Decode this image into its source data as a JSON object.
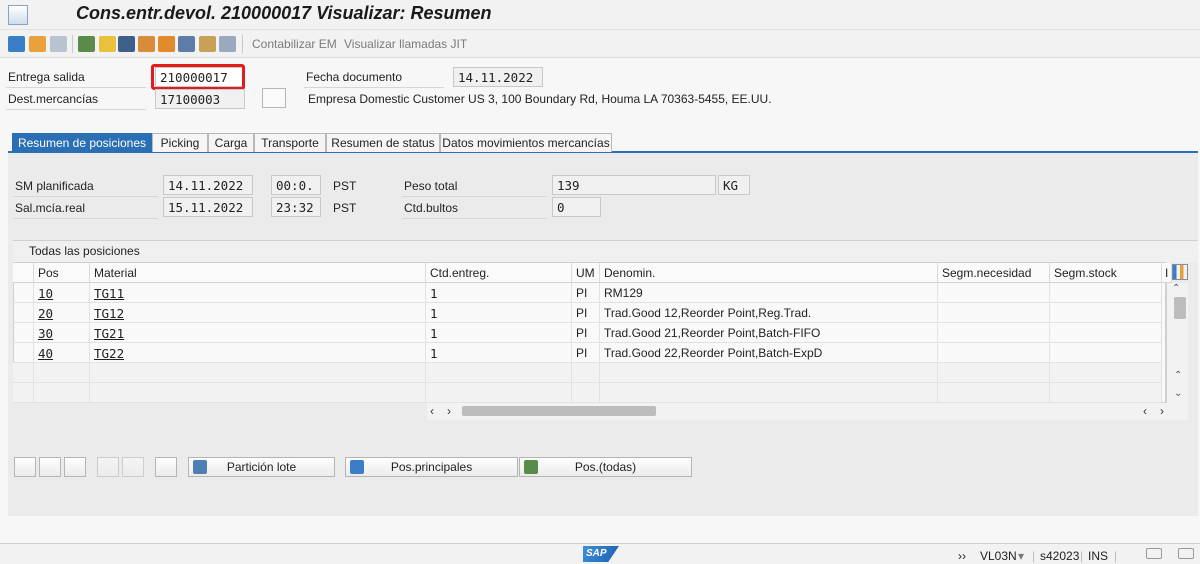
{
  "window": {
    "title": "Cons.entr.devol. 210000017 Visualizar: Resumen"
  },
  "toolbar": {
    "post_goods_receipt": "Contabilizar EM",
    "view_jit_calls": "Visualizar llamadas JIT"
  },
  "header": {
    "outbound_delivery_label": "Entrega salida",
    "outbound_delivery_value": "210000017",
    "doc_date_label": "Fecha documento",
    "doc_date_value": "14.11.2022",
    "ship_to_label": "Dest.mercancías",
    "ship_to_value": "17100003",
    "ship_to_address": "Empresa Domestic Customer US 3, 100 Boundary Rd, Houma LA 70363-5455, EE.UU."
  },
  "tabs": [
    {
      "label": "Resumen de posiciones",
      "active": true
    },
    {
      "label": "Picking"
    },
    {
      "label": "Carga"
    },
    {
      "label": "Transporte"
    },
    {
      "label": "Resumen de status"
    },
    {
      "label": "Datos movimientos mercancías"
    }
  ],
  "overview": {
    "planned_gi_label": "SM planificada",
    "planned_gi_date": "14.11.2022",
    "planned_gi_time": "00:0.",
    "planned_gi_tz": "PST",
    "actual_gi_label": "Sal.mcía.real",
    "actual_gi_date": "15.11.2022",
    "actual_gi_time": "23:32",
    "actual_gi_tz": "PST",
    "total_weight_label": "Peso total",
    "total_weight_value": "139",
    "weight_unit": "KG",
    "packages_label": "Ctd.bultos",
    "packages_value": "0"
  },
  "items_table": {
    "title": "Todas las posiciones",
    "columns": [
      "Pos",
      "Material",
      "Ctd.entreg.",
      "UM",
      "Denomin.",
      "Segm.necesidad",
      "Segm.stock",
      "I"
    ],
    "rows": [
      {
        "pos": "10",
        "material": "TG11",
        "qty": "1",
        "uom": "PI",
        "desc": "RM129"
      },
      {
        "pos": "20",
        "material": "TG12",
        "qty": "1",
        "uom": "PI",
        "desc": "Trad.Good 12,Reorder Point,Reg.Trad."
      },
      {
        "pos": "30",
        "material": "TG21",
        "qty": "1",
        "uom": "PI",
        "desc": "Trad.Good 21,Reorder Point,Batch-FIFO"
      },
      {
        "pos": "40",
        "material": "TG22",
        "qty": "1",
        "uom": "PI",
        "desc": "Trad.Good 22,Reorder Point,Batch-ExpD"
      }
    ]
  },
  "buttons": {
    "batch_split": "Partición lote",
    "main_items": "Pos.principales",
    "all_items": "Pos.(todas)"
  },
  "statusbar": {
    "transaction": "VL03N",
    "system": "s42023",
    "mode": "INS",
    "sap_logo": "SAP"
  },
  "colors": {
    "accent": "#2a6fb4",
    "highlight": "#e21c1c"
  }
}
